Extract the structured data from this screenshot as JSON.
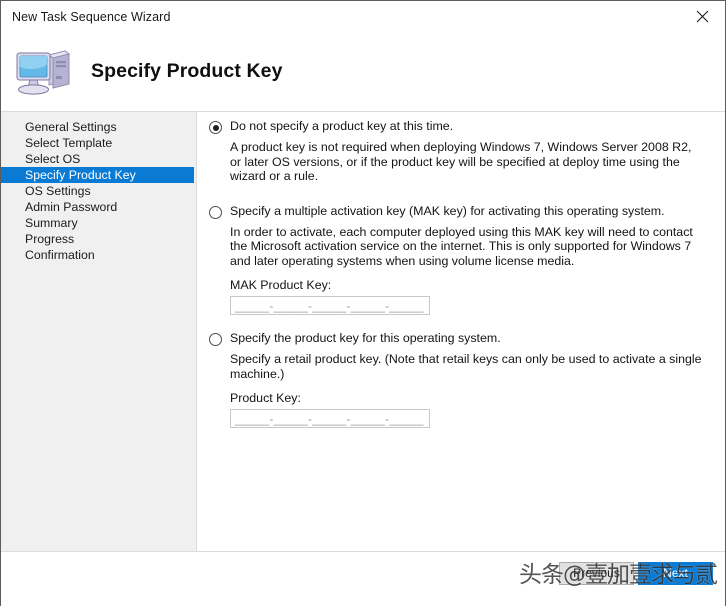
{
  "window": {
    "title": "New Task Sequence Wizard",
    "close_icon": "close-icon"
  },
  "header": {
    "icon": "computer-icon",
    "title": "Specify Product Key"
  },
  "sidebar": {
    "items": [
      {
        "label": "General Settings",
        "selected": false
      },
      {
        "label": "Select Template",
        "selected": false
      },
      {
        "label": "Select OS",
        "selected": false
      },
      {
        "label": "Specify Product Key",
        "selected": true
      },
      {
        "label": "OS Settings",
        "selected": false
      },
      {
        "label": "Admin Password",
        "selected": false
      },
      {
        "label": "Summary",
        "selected": false
      },
      {
        "label": "Progress",
        "selected": false
      },
      {
        "label": "Confirmation",
        "selected": false
      }
    ],
    "selected_bg": "#0a7bd4"
  },
  "options": {
    "option1": {
      "label": "Do not specify a product key at this time.",
      "description": "A product key is not required when deploying Windows 7, Windows Server 2008 R2, or later OS versions, or if the product key will be specified at deploy time using the wizard or a rule.",
      "selected": true
    },
    "option2": {
      "label": "Specify a multiple activation key (MAK key) for activating this operating system.",
      "description": "In order to activate, each computer deployed using this MAK key will need to contact the Microsoft activation service on the internet.  This is only supported for Windows 7 and later operating systems when using volume license media.",
      "selected": false,
      "field_label": "MAK Product Key:",
      "field_value": "",
      "field_mask": "_____-_____-_____-_____-_____"
    },
    "option3": {
      "label": "Specify the product key for this operating system.",
      "description": "Specify a retail product key.  (Note that retail keys can only be used to activate a single machine.)",
      "selected": false,
      "field_label": "Product Key:",
      "field_value": "",
      "field_mask": "_____-_____-_____-_____-_____"
    }
  },
  "footer": {
    "previous_label": "Previous",
    "next_label": "Next"
  },
  "watermark": {
    "text": "头条@壹加壹求与贰"
  }
}
